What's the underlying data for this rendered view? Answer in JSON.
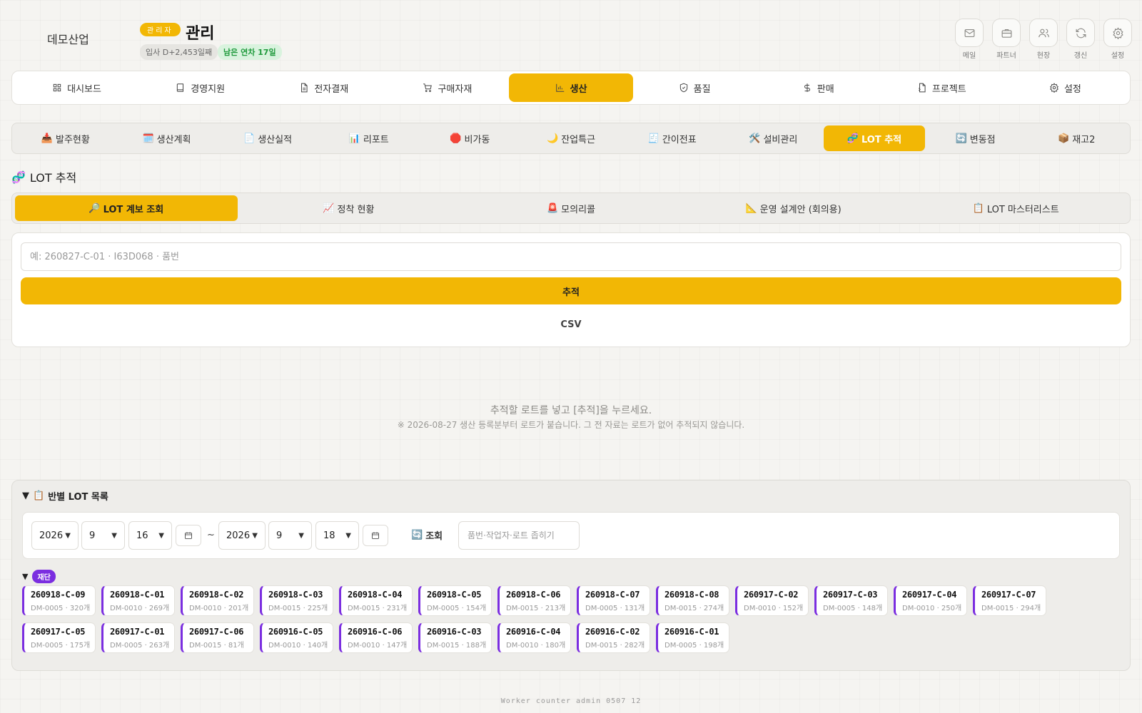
{
  "header": {
    "company": "데모산업",
    "role_badge": "관리자",
    "title": "관리",
    "chips": {
      "tenure": "입사 D+2,453일째",
      "leave": "남은 연차 17일"
    },
    "icons": [
      {
        "label": "메일",
        "icon": "mail-icon"
      },
      {
        "label": "파트너",
        "icon": "briefcase-icon"
      },
      {
        "label": "현장",
        "icon": "users-icon"
      },
      {
        "label": "갱신",
        "icon": "refresh-icon"
      },
      {
        "label": "설정",
        "icon": "gear-icon"
      }
    ]
  },
  "main_nav": [
    {
      "label": "대시보드",
      "icon": "grid-icon"
    },
    {
      "label": "경영지원",
      "icon": "book-icon"
    },
    {
      "label": "전자결재",
      "icon": "document-icon"
    },
    {
      "label": "구매자재",
      "icon": "cart-icon"
    },
    {
      "label": "생산",
      "icon": "chart-icon",
      "active": true
    },
    {
      "label": "품질",
      "icon": "shield-icon"
    },
    {
      "label": "판매",
      "icon": "dollar-icon"
    },
    {
      "label": "프로젝트",
      "icon": "file-icon"
    },
    {
      "label": "설정",
      "icon": "gear-icon"
    }
  ],
  "sub_nav": [
    {
      "emoji": "📥",
      "label": "발주현황"
    },
    {
      "emoji": "🗓️",
      "label": "생산계획"
    },
    {
      "emoji": "📄",
      "label": "생산실적"
    },
    {
      "emoji": "📊",
      "label": "리포트"
    },
    {
      "emoji": "🛑",
      "label": "비가동"
    },
    {
      "emoji": "🌙",
      "label": "잔업특근"
    },
    {
      "emoji": "🧾",
      "label": "간이전표"
    },
    {
      "emoji": "🛠️",
      "label": "설비관리"
    },
    {
      "emoji": "🧬",
      "label": "LOT 추적",
      "active": true
    },
    {
      "emoji": "🔄",
      "label": "변동점"
    },
    {
      "emoji": "📦",
      "label": "재고2"
    }
  ],
  "section": {
    "emoji": "🧬",
    "title": "LOT 추적"
  },
  "tabs": [
    {
      "emoji": "🔎",
      "label": "LOT 계보 조회",
      "active": true
    },
    {
      "emoji": "📈",
      "label": "정착 현황"
    },
    {
      "emoji": "🚨",
      "label": "모의리콜"
    },
    {
      "emoji": "📐",
      "label": "운영 설계안 (회의용)"
    },
    {
      "emoji": "📋",
      "label": "LOT 마스터리스트"
    }
  ],
  "search": {
    "placeholder": "예: 260827-C-01 · I63D068 · 품번",
    "value": "",
    "track_label": "추적",
    "csv_label": "CSV"
  },
  "empty_state": {
    "message": "추적할 로트를 넣고 [추적]을 누르세요.",
    "note": "※ 2026-08-27 생산 등록분부터 로트가 붙습니다. 그 전 자료는 로트가 없어 추적되지 않습니다."
  },
  "lot_list": {
    "toggle": "▼",
    "emoji": "📋",
    "title": "반별 LOT 목록",
    "filter": {
      "from": {
        "year": "2026",
        "month": "9",
        "day": "16"
      },
      "tilde": "~",
      "to": {
        "year": "2026",
        "month": "9",
        "day": "18"
      },
      "query_emoji": "🔄",
      "query_label": "조회",
      "search_placeholder": "품번·작업자·로트 좁히기"
    },
    "group": {
      "toggle": "▼",
      "name": "재단"
    },
    "lots": [
      {
        "code": "260918-C-09",
        "meta": "DM-0005 · 320개"
      },
      {
        "code": "260918-C-01",
        "meta": "DM-0010 · 269개"
      },
      {
        "code": "260918-C-02",
        "meta": "DM-0010 · 201개"
      },
      {
        "code": "260918-C-03",
        "meta": "DM-0015 · 225개"
      },
      {
        "code": "260918-C-04",
        "meta": "DM-0015 · 231개"
      },
      {
        "code": "260918-C-05",
        "meta": "DM-0005 · 154개"
      },
      {
        "code": "260918-C-06",
        "meta": "DM-0015 · 213개"
      },
      {
        "code": "260918-C-07",
        "meta": "DM-0005 · 131개"
      },
      {
        "code": "260918-C-08",
        "meta": "DM-0015 · 274개"
      },
      {
        "code": "260917-C-02",
        "meta": "DM-0010 · 152개"
      },
      {
        "code": "260917-C-03",
        "meta": "DM-0005 · 148개"
      },
      {
        "code": "260917-C-04",
        "meta": "DM-0010 · 250개"
      },
      {
        "code": "260917-C-07",
        "meta": "DM-0015 · 294개"
      },
      {
        "code": "260917-C-05",
        "meta": "DM-0005 · 175개"
      },
      {
        "code": "260917-C-01",
        "meta": "DM-0005 · 263개"
      },
      {
        "code": "260917-C-06",
        "meta": "DM-0015 · 81개"
      },
      {
        "code": "260916-C-05",
        "meta": "DM-0010 · 140개"
      },
      {
        "code": "260916-C-06",
        "meta": "DM-0010 · 147개"
      },
      {
        "code": "260916-C-03",
        "meta": "DM-0015 · 188개"
      },
      {
        "code": "260916-C-04",
        "meta": "DM-0010 · 180개"
      },
      {
        "code": "260916-C-02",
        "meta": "DM-0015 · 282개"
      },
      {
        "code": "260916-C-01",
        "meta": "DM-0005 · 198개"
      }
    ]
  },
  "footer": "Worker counter admin 0507 12",
  "colors": {
    "accent": "#f2b705",
    "group": "#7b2ee0",
    "leave_green": "#1f9a3c"
  }
}
